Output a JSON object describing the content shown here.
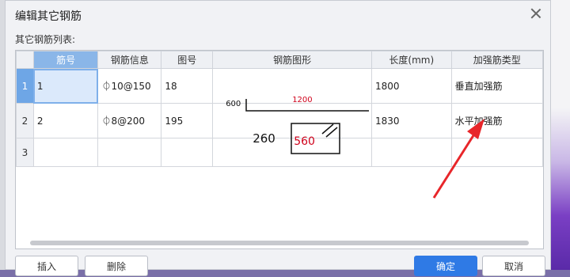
{
  "dialog": {
    "title": "编辑其它钢筋",
    "list_label": "其它钢筋列表:"
  },
  "table": {
    "headers": [
      "筋号",
      "钢筋信息",
      "图号",
      "钢筋图形",
      "长度(mm)",
      "加强筋类型"
    ],
    "rows": [
      {
        "num": "1",
        "name": "1",
        "info": "⏀10@150",
        "fig": "18",
        "length": "1800",
        "type": "垂直加强筋",
        "shape": {
          "left_dim": "600",
          "main_dim": "1200"
        }
      },
      {
        "num": "2",
        "name": "2",
        "info": "⏀8@200",
        "fig": "195",
        "length": "1830",
        "type": "水平加强筋",
        "shape": {
          "left_dim": "260",
          "main_dim": "560"
        }
      },
      {
        "num": "3",
        "name": "",
        "info": "",
        "fig": "",
        "length": "",
        "type": ""
      }
    ]
  },
  "buttons": {
    "insert": "插入",
    "delete": "删除",
    "ok": "确定",
    "cancel": "取消"
  },
  "colors": {
    "accent": "#2f7ae5",
    "dim_red": "#d0021b",
    "arrow_red": "#e8262a"
  }
}
